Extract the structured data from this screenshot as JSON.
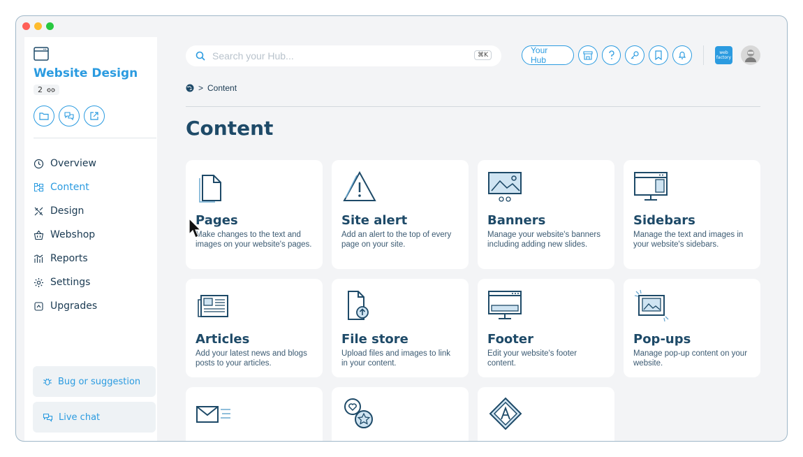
{
  "window": {
    "dot_colors": [
      "#ff5f57",
      "#febc2e",
      "#28c840"
    ]
  },
  "sidebar": {
    "title": "Website Design",
    "count": "2",
    "nav": [
      {
        "label": "Overview",
        "icon": "clock-icon",
        "active": false
      },
      {
        "label": "Content",
        "icon": "content-icon",
        "active": true
      },
      {
        "label": "Design",
        "icon": "design-icon",
        "active": false
      },
      {
        "label": "Webshop",
        "icon": "basket-icon",
        "active": false
      },
      {
        "label": "Reports",
        "icon": "reports-icon",
        "active": false
      },
      {
        "label": "Settings",
        "icon": "gear-icon",
        "active": false
      },
      {
        "label": "Upgrades",
        "icon": "upgrade-icon",
        "active": false
      }
    ],
    "bug_label": "Bug or suggestion",
    "chat_label": "Live chat"
  },
  "header": {
    "search_placeholder": "Search your Hub...",
    "search_shortcut": "⌘K",
    "your_hub": "Your Hub",
    "brand_text": "web factory"
  },
  "breadcrumb": {
    "current": "Content"
  },
  "page": {
    "title": "Content"
  },
  "cards": [
    {
      "title": "Pages",
      "desc": "Make changes to the text and images on your website's pages."
    },
    {
      "title": "Site alert",
      "desc": "Add an alert to the top of every page on your site."
    },
    {
      "title": "Banners",
      "desc": "Manage your website's banners including adding new slides."
    },
    {
      "title": "Sidebars",
      "desc": "Manage the text and images in your website's sidebars."
    },
    {
      "title": "Articles",
      "desc": "Add your latest news and blogs posts to your articles."
    },
    {
      "title": "File store",
      "desc": "Upload files and images to link in your content."
    },
    {
      "title": "Footer",
      "desc": "Edit your website's footer content."
    },
    {
      "title": "Pop-ups",
      "desc": "Manage pop-up content on your website."
    },
    {
      "title": "",
      "desc": ""
    },
    {
      "title": "",
      "desc": ""
    },
    {
      "title": "",
      "desc": ""
    }
  ],
  "colors": {
    "accent": "#2b9be0",
    "title": "#1e4a68"
  }
}
